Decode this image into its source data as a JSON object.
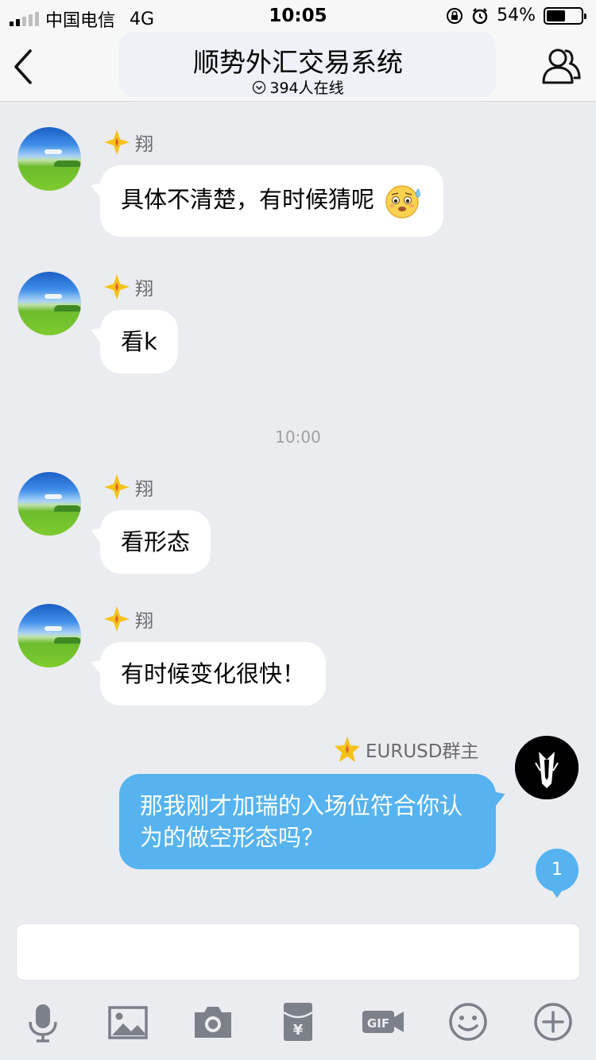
{
  "status_bar": {
    "carrier": "中国电信",
    "network": "4G",
    "time": "10:05",
    "battery_percent": "54%",
    "battery_level": 0.54
  },
  "header": {
    "title": "顺势外汇交易系统",
    "online_count": "394人在线"
  },
  "messages": [
    {
      "sender": "翔",
      "text": "具体不清楚，有时候猜呢",
      "emoji": "anxious-sweat-emoji"
    },
    {
      "sender": "翔",
      "text": "看k"
    },
    {
      "sender": "翔",
      "text": "看形态"
    },
    {
      "sender": "翔",
      "text": "有时候变化很快！"
    },
    {
      "sender": "EURUSD群主",
      "text": "那我刚才加瑞的入场位符合你认为的做空形态吗？"
    }
  ],
  "timestamp": "10:00",
  "unread_count": "1",
  "toolbar": {
    "icons": [
      "microphone-icon",
      "image-icon",
      "camera-icon",
      "red-packet-icon",
      "gif-icon",
      "emoji-icon",
      "plus-icon"
    ]
  },
  "colors": {
    "bubble_self": "#56b3f0",
    "background": "#ebecf0",
    "badge_star": "#f5c21b"
  }
}
